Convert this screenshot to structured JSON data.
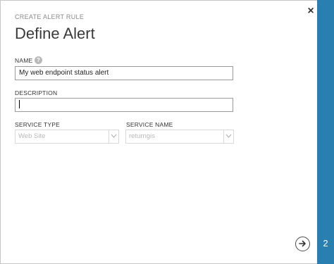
{
  "dialog": {
    "header_label": "CREATE ALERT RULE",
    "title": "Define Alert",
    "step_number": "2",
    "accent_color": "#2a7fb1"
  },
  "form": {
    "name": {
      "label": "NAME",
      "value": "My web endpoint status alert"
    },
    "description": {
      "label": "DESCRIPTION",
      "value": ""
    },
    "service_type": {
      "label": "SERVICE TYPE",
      "selected": "Web Site"
    },
    "service_name": {
      "label": "SERVICE NAME",
      "selected": "returngis"
    }
  },
  "icons": {
    "close": "close-icon",
    "help": "help-icon",
    "next": "arrow-right-circle-icon",
    "dropdown": "chevron-down-icon"
  },
  "glyphs": {
    "close": "×",
    "help": "?"
  }
}
